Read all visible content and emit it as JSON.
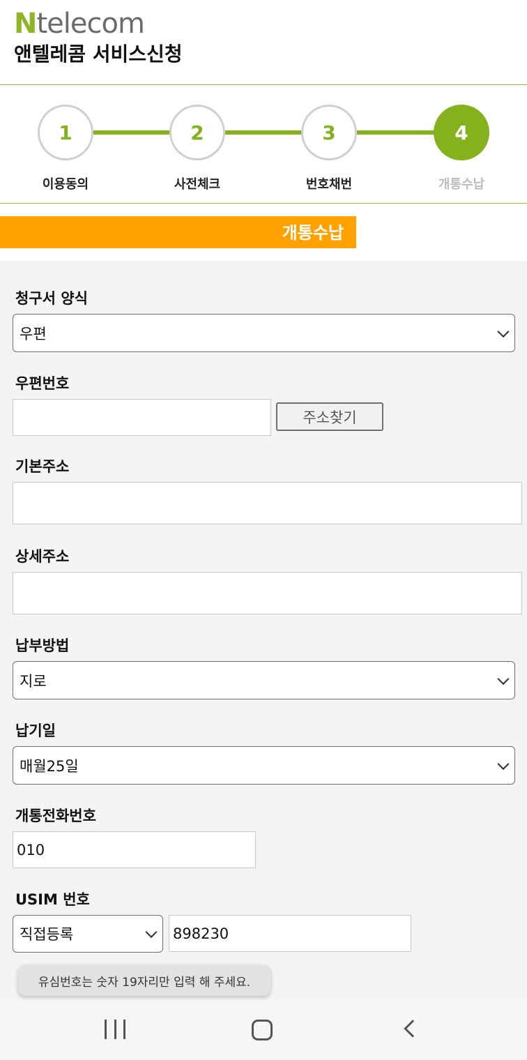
{
  "header": {
    "logo_n": "N",
    "logo_rest": "telecom",
    "title": "앤텔레콤 서비스신청"
  },
  "steps": [
    {
      "number": "1",
      "label": "이용동의"
    },
    {
      "number": "2",
      "label": "사전체크"
    },
    {
      "number": "3",
      "label": "번호채번"
    },
    {
      "number": "4",
      "label": "개통수납"
    }
  ],
  "section_title": "개통수납",
  "form": {
    "bill_format": {
      "label": "청구서 양식",
      "selected": "우편"
    },
    "postal_code": {
      "label": "우편번호",
      "value": "",
      "button": "주소찾기"
    },
    "base_address": {
      "label": "기본주소",
      "value": ""
    },
    "detail_address": {
      "label": "상세주소",
      "value": ""
    },
    "payment_method": {
      "label": "납부방법",
      "selected": "지로"
    },
    "due_date": {
      "label": "납기일",
      "selected": "매월25일"
    },
    "phone": {
      "label": "개통전화번호",
      "value": "010"
    },
    "usim": {
      "label": "USIM 번호",
      "selected": "직접등록",
      "value": "898230"
    }
  },
  "toast": "유심번호는 숫자 19자리만 입력 해 주세요.",
  "colors": {
    "accent": "#84b21d",
    "orange": "#ffa200"
  },
  "nav_icons": [
    "recent-apps-icon",
    "home-icon",
    "back-icon"
  ]
}
